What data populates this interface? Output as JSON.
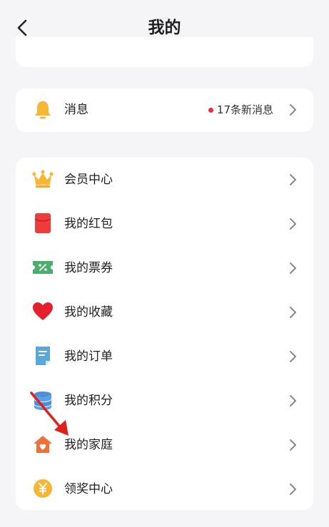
{
  "header": {
    "title": "我的",
    "back_icon": "back-chevron-icon"
  },
  "message": {
    "label": "消息",
    "icon": "bell-icon",
    "badge_text": "17条新消息",
    "dot_color": "#e5303f"
  },
  "menu": [
    {
      "label": "会员中心",
      "icon": "crown-icon"
    },
    {
      "label": "我的红包",
      "icon": "red-envelope-icon"
    },
    {
      "label": "我的票券",
      "icon": "ticket-icon"
    },
    {
      "label": "我的收藏",
      "icon": "heart-icon"
    },
    {
      "label": "我的订单",
      "icon": "order-document-icon"
    },
    {
      "label": "我的积分",
      "icon": "coins-stack-icon"
    },
    {
      "label": "我的家庭",
      "icon": "home-heart-icon"
    },
    {
      "label": "领奖中心",
      "icon": "yen-coin-icon"
    }
  ],
  "colors": {
    "background": "#f5f5f7",
    "card": "#ffffff",
    "annotation_arrow": "#e0201c"
  }
}
